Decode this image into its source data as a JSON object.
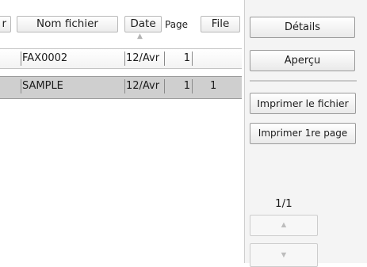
{
  "file_list": {
    "columns": {
      "user": "r",
      "file_name": "Nom fichier",
      "date": "Date",
      "pages": "Page",
      "file": "File"
    },
    "sort_indicator": "▲",
    "rows": [
      {
        "file_name": "FAX0002",
        "date": "12/Avr",
        "pages": "1",
        "file": ""
      },
      {
        "file_name": "SAMPLE",
        "date": "12/Avr",
        "pages": "1",
        "file": "1"
      }
    ]
  },
  "actions": {
    "details": "Détails",
    "preview": "Aperçu",
    "print_file": "Imprimer le fichier",
    "print_first_page": "Imprimer 1re page"
  },
  "pagination": {
    "indicator": "1/1",
    "up_icon": "triangle-up-icon",
    "down_icon": "triangle-down-icon",
    "up_glyph": "▲",
    "down_glyph": "▼"
  },
  "colors": {
    "selected_row": "#cfcfcf",
    "panel_background": "#f4f4f4",
    "disabled_arrow": "#bdbdbd"
  }
}
